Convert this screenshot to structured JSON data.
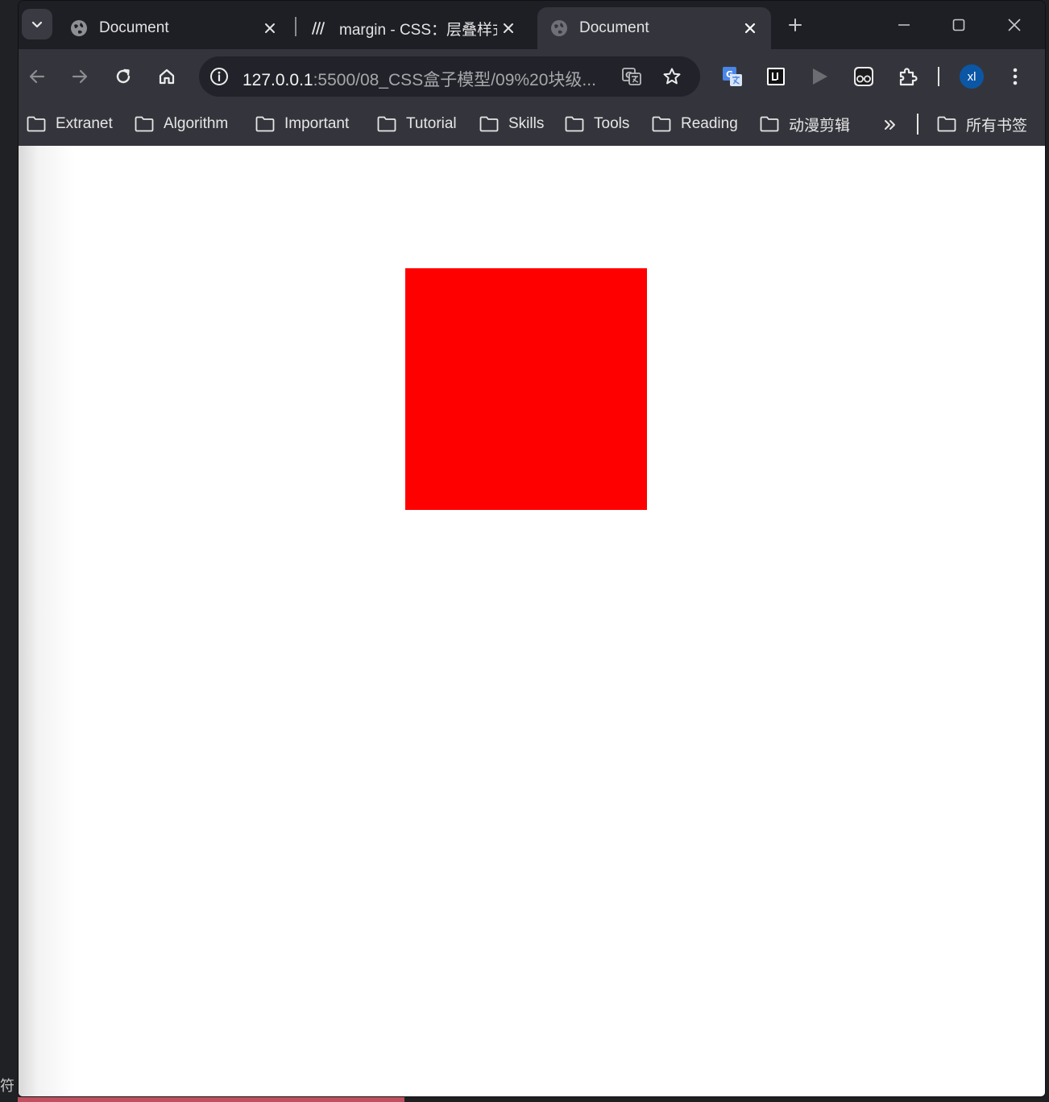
{
  "browser": {
    "tabs": [
      {
        "title": "Document",
        "active": false,
        "favicon": "globe-icon"
      },
      {
        "title": "margin - CSS：层叠样式",
        "active": false,
        "favicon": "mdn-icon"
      },
      {
        "title": "Document",
        "active": true,
        "favicon": "globe-icon"
      }
    ],
    "address_bar": {
      "host": "127.0.0.1",
      "path": ":5500/08_CSS盒子模型/09%20块级..."
    },
    "profile_initials": "xl",
    "extensions": [
      "google-translate-icon",
      "leetcode-icon",
      "video-play-icon",
      "tampermonkey-icon",
      "puzzle-icon"
    ]
  },
  "bookmarks": [
    {
      "label": "Extranet"
    },
    {
      "label": "Algorithm"
    },
    {
      "label": "Important"
    },
    {
      "label": "Tutorial"
    },
    {
      "label": "Skills"
    },
    {
      "label": "Tools"
    },
    {
      "label": "Reading"
    },
    {
      "label": "动漫剪辑"
    }
  ],
  "bookmarks_all_label": "所有书签",
  "page": {
    "box_color": "#ff0000"
  },
  "desktop_glyph": "符"
}
